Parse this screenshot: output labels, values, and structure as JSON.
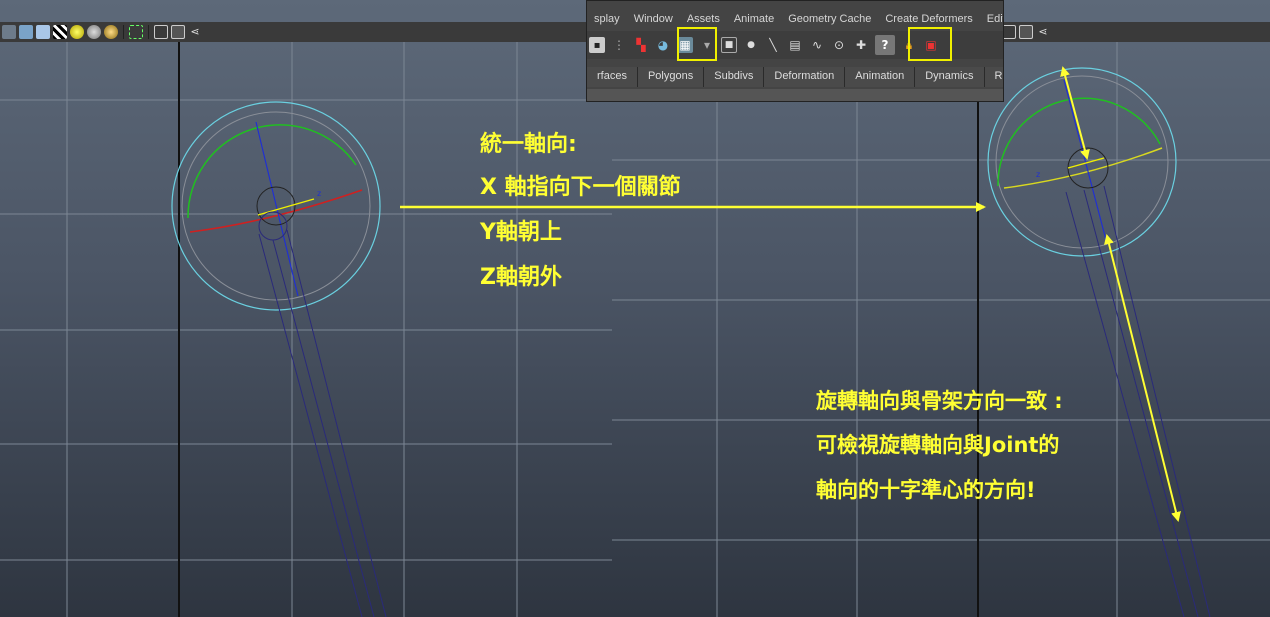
{
  "menubar": {
    "items": [
      "splay",
      "Window",
      "Assets",
      "Animate",
      "Geometry Cache",
      "Create Deformers",
      "Edit De"
    ]
  },
  "shelf_tabs": [
    "rfaces",
    "Polygons",
    "Subdivs",
    "Deformation",
    "Animation",
    "Dynamics",
    "Re"
  ],
  "shelf_icons": {
    "help_glyph": "?"
  },
  "annotations": {
    "unify_title": "統一軸向:",
    "x_axis": "X 軸指向下一個關節",
    "y_axis": "Y軸朝上",
    "z_axis": "Z軸朝外",
    "rotation_line1": "旋轉軸向與骨架方向一致 :",
    "rotation_line2": "可檢視旋轉軸向與Joint的",
    "rotation_line3": "軸向的十字準心的方向!"
  },
  "colors": {
    "annotation": "#ffff33",
    "highlight": "#f0f000",
    "rotate_ring_outer": "#6ad0e0",
    "rotate_x": "#d02020",
    "rotate_y": "#20c020",
    "rotate_z": "#2030d0",
    "bone": "#2a2a7a"
  },
  "axis_labels": {
    "z": "z"
  }
}
